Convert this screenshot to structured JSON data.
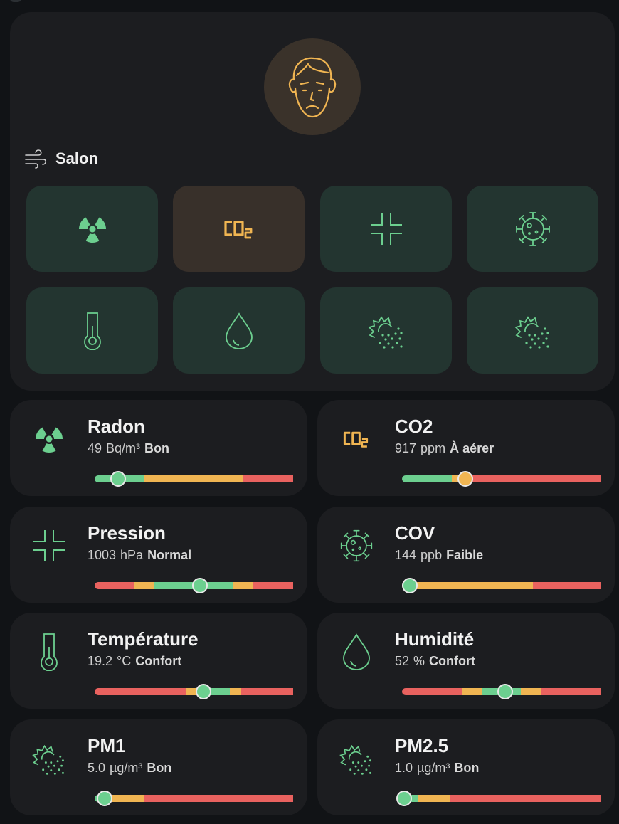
{
  "room": {
    "name": "Salon",
    "face_icon": "sad-face-icon",
    "room_icon": "wind-icon",
    "tiles": [
      {
        "icon": "radiation-icon",
        "status": "good"
      },
      {
        "icon": "co2-icon",
        "status": "warning"
      },
      {
        "icon": "pressure-icon",
        "status": "good"
      },
      {
        "icon": "virus-icon",
        "status": "good"
      },
      {
        "icon": "thermometer-icon",
        "status": "good"
      },
      {
        "icon": "water-drop-icon",
        "status": "good"
      },
      {
        "icon": "dust-icon",
        "status": "good"
      },
      {
        "icon": "dust-icon",
        "status": "good"
      }
    ]
  },
  "sensors": {
    "radon": {
      "title": "Radon",
      "value": "49",
      "unit": "Bq/m³",
      "state": "Bon",
      "position": 0.12
    },
    "co2": {
      "title": "CO2",
      "value": "917",
      "unit": "ppm",
      "state": "À aérer",
      "position": 0.32
    },
    "pression": {
      "title": "Pression",
      "value": "1003",
      "unit": "hPa",
      "state": "Normal",
      "position": 0.53
    },
    "cov": {
      "title": "COV",
      "value": "144",
      "unit": "ppb",
      "state": "Faible",
      "position": 0.04
    },
    "temperature": {
      "title": "Température",
      "value": "19.2",
      "unit": "°C",
      "state": "Confort",
      "position": 0.55
    },
    "humidite": {
      "title": "Humidité",
      "value": "52",
      "unit": "%",
      "state": "Confort",
      "position": 0.52
    },
    "pm1": {
      "title": "PM1",
      "value": "5.0",
      "unit": "µg/m³",
      "state": "Bon",
      "position": 0.05
    },
    "pm25": {
      "title": "PM2.5",
      "value": "1.0",
      "unit": "µg/m³",
      "state": "Bon",
      "position": 0.01
    }
  },
  "colors": {
    "good": "#6ccf8f",
    "warning": "#f0b552",
    "bad": "#e9625f"
  }
}
